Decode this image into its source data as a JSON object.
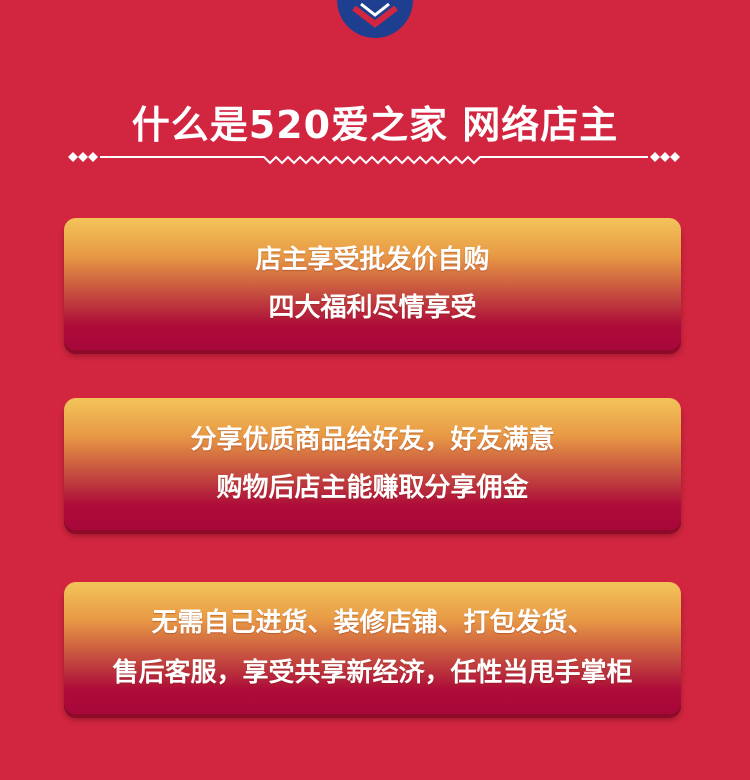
{
  "colors": {
    "background": "#d22640",
    "badge": "#1e3f8f",
    "card_top": "#f3c45a",
    "card_bottom": "#a8073a"
  },
  "header": {
    "icon": "chevron-down-icon",
    "title": "什么是520爱之家 网络店主"
  },
  "cards": [
    {
      "lines": [
        "店主享受批发价自购",
        "四大福利尽情享受"
      ]
    },
    {
      "lines": [
        "分享优质商品给好友，好友满意",
        "购物后店主能赚取分享佣金"
      ]
    },
    {
      "lines": [
        "无需自己进货、装修店铺、打包发货、",
        "售后客服，享受共享新经济，任性当甩手掌柜"
      ]
    }
  ]
}
